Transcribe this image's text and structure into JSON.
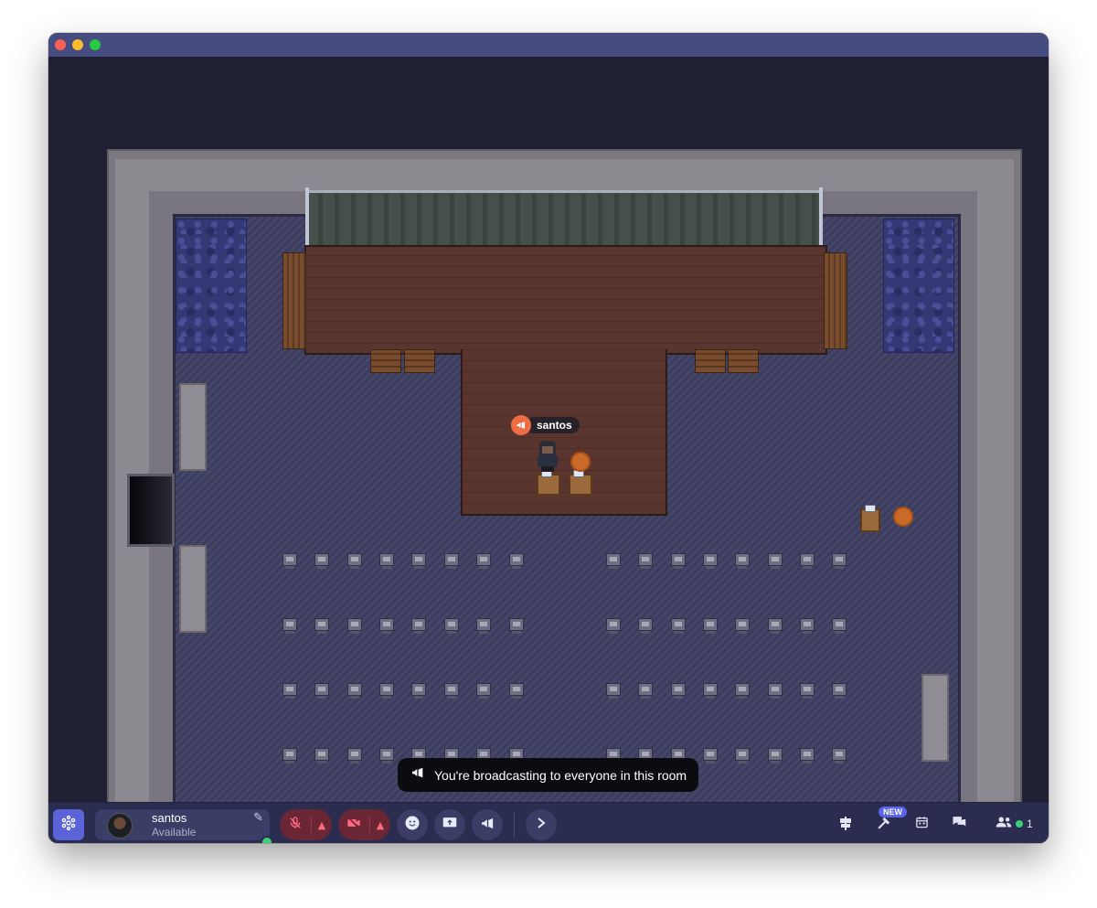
{
  "app": {
    "window_colors": {
      "titlebar": "#464c80",
      "background": "#202033",
      "bar": "#2a2d4f"
    }
  },
  "avatar": {
    "name": "santos",
    "nameplate_icon": "megaphone-icon"
  },
  "toast": {
    "icon": "megaphone-icon",
    "text": "You're broadcasting to everyone in this room"
  },
  "bottom_bar": {
    "logo_icon": "gather-logo-icon",
    "profile": {
      "name": "santos",
      "status": "Available",
      "edit_icon": "pencil-icon",
      "online_color": "#3ccf7a"
    },
    "mic_icon": "mic-off-icon",
    "camera_icon": "camera-off-icon",
    "emoji_icon": "smiley-icon",
    "screen_share_icon": "screen-share-icon",
    "broadcast_icon": "megaphone-icon",
    "expand_icon": "chevron-right-icon",
    "right": {
      "directions_icon": "signpost-icon",
      "build_icon": "hammer-icon",
      "new_badge": "NEW",
      "calendar_icon": "calendar-icon",
      "chat_icon": "chat-icon",
      "participants_icon": "people-icon",
      "participant_count": "1"
    }
  }
}
